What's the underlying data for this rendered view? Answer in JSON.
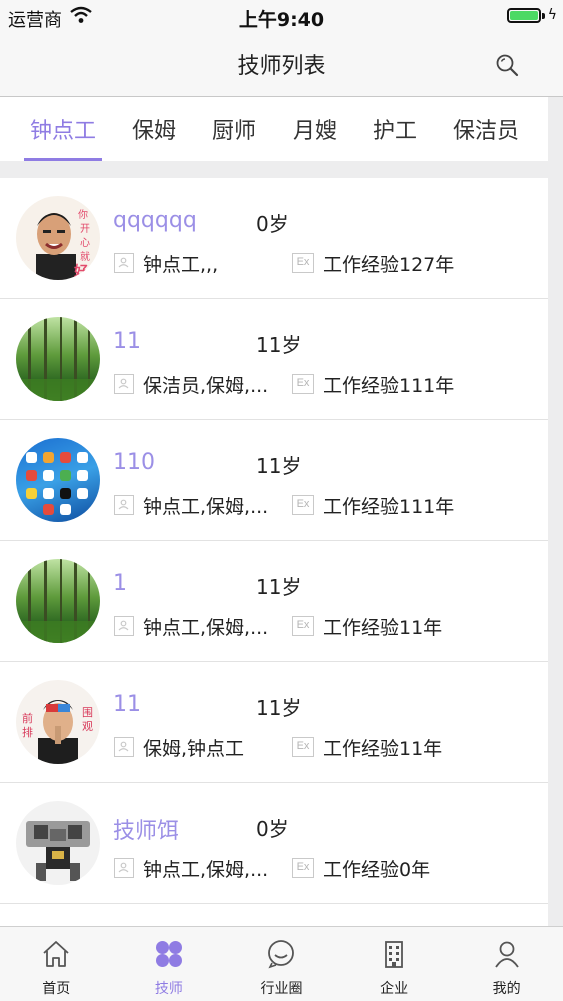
{
  "status_bar": {
    "carrier": "运营商",
    "time": "上午9:40"
  },
  "nav": {
    "title": "技师列表"
  },
  "tabs": [
    {
      "label": "钟点工",
      "active": true
    },
    {
      "label": "保姆"
    },
    {
      "label": "厨师"
    },
    {
      "label": "月嫂"
    },
    {
      "label": "护工"
    },
    {
      "label": "保洁员"
    }
  ],
  "technicians": [
    {
      "name": "qqqqqq",
      "age": "0岁",
      "categories": "钟点工,,,",
      "experience": "工作经验127年",
      "avatar": "cartoon-man-avatar"
    },
    {
      "name": "11",
      "age": "11岁",
      "categories": "保洁员,保姆,...",
      "experience": "工作经验111年",
      "avatar": "forest-avatar"
    },
    {
      "name": "110",
      "age": "11岁",
      "categories": "钟点工,保姆,...",
      "experience": "工作经验111年",
      "avatar": "app-screen-avatar"
    },
    {
      "name": "1",
      "age": "11岁",
      "categories": "钟点工,保姆,...",
      "experience": "工作经验11年",
      "avatar": "forest-avatar"
    },
    {
      "name": "11",
      "age": "11岁",
      "categories": "保姆,钟点工",
      "experience": "工作经验11年",
      "avatar": "cartoon-boy-avatar"
    },
    {
      "name": "技师饵",
      "age": "0岁",
      "categories": "钟点工,保姆,...",
      "experience": "工作经验0年",
      "avatar": "robot-avatar"
    }
  ],
  "ex_icon_text": "Ex",
  "tab_bar": [
    {
      "label": "首页",
      "icon": "home-icon"
    },
    {
      "label": "技师",
      "icon": "grid-icon",
      "active": true
    },
    {
      "label": "行业圈",
      "icon": "chat-icon"
    },
    {
      "label": "企业",
      "icon": "building-icon"
    },
    {
      "label": "我的",
      "icon": "person-icon"
    }
  ],
  "colors": {
    "accent": "#8f7ce3",
    "name": "#9b8fe6",
    "battery": "#4cd964"
  }
}
